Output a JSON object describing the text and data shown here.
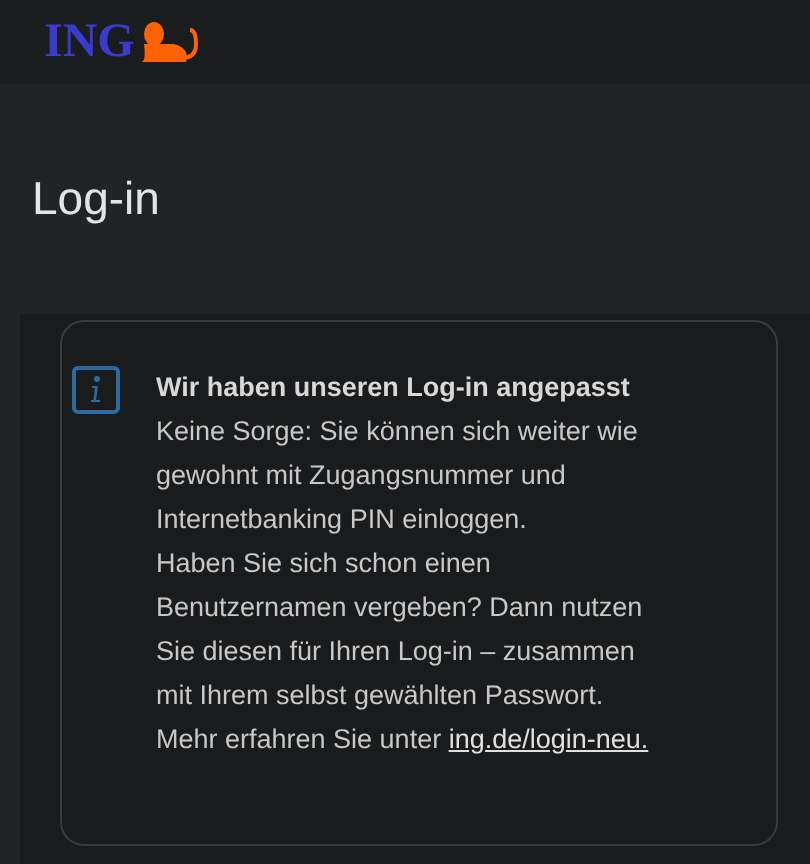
{
  "header": {
    "logo_text": "ING"
  },
  "page_title": "Log-in",
  "notice": {
    "title": "Wir haben unseren Log-in angepasst",
    "paragraphs": [
      "Keine Sorge: Sie können sich weiter wie gewohnt mit Zugangsnummer und Internetbanking PIN einloggen.",
      "Haben Sie sich schon einen Benutzernamen vergeben? Dann nutzen Sie diesen für Ihren Log-in – zusammen mit Ihrem selbst gewählten Passwort."
    ],
    "more_text": "Mehr erfahren Sie unter ",
    "link": "ing.de/login-neu."
  }
}
